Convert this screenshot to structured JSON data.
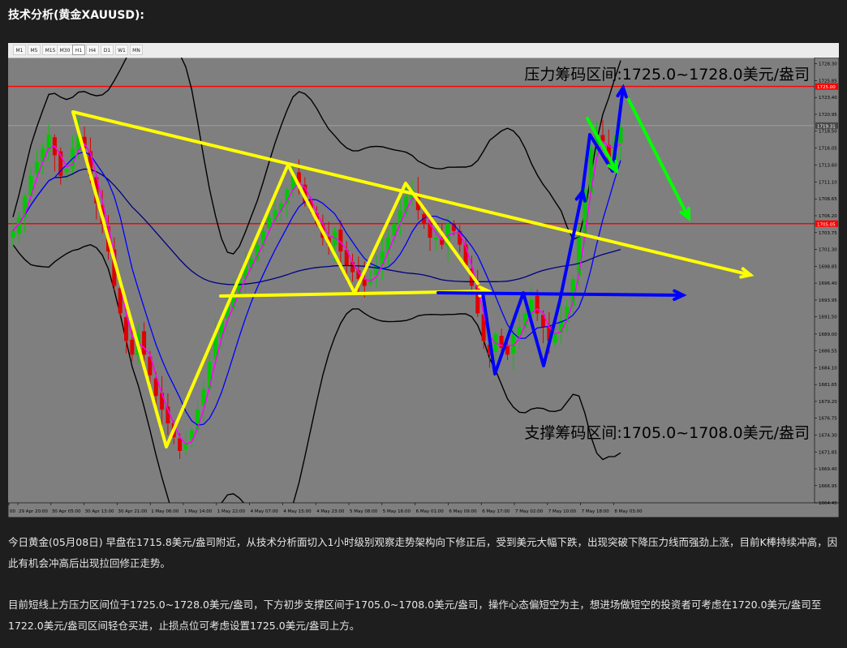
{
  "heading": "技术分析(黄金XAUUSD):",
  "timeframes": [
    "M1",
    "M5",
    "M15",
    "M30",
    "H1",
    "H4",
    "D1",
    "W1",
    "MN"
  ],
  "active_timeframe": "H1",
  "colors": {
    "background": "#7f7f7f",
    "bull_candle": "#00c800",
    "bear_candle": "#e00000",
    "trend_lines": "#ffff00",
    "resistance_line": "#ff0000",
    "arrow_up": "#0000ff",
    "arrow_down": "#00ff00",
    "bollinger": "#000000",
    "ma": "#0000ff",
    "ma_fast": "#ff00ff",
    "ma_slow": "#000080"
  },
  "chart_data": {
    "type": "candlestick",
    "ylim": [
      1664.45,
      1729.2
    ],
    "y_ticks": [
      "1728.30",
      "1725.85",
      "1723.40",
      "1720.95",
      "1718.50",
      "1716.05",
      "1713.60",
      "1711.10",
      "1708.65",
      "1706.20",
      "1703.75",
      "1701.30",
      "1698.85",
      "1696.40",
      "1693.95",
      "1691.50",
      "1689.00",
      "1686.55",
      "1684.10",
      "1681.65",
      "1679.20",
      "1676.75",
      "1674.30",
      "1671.85",
      "1669.40",
      "1666.95",
      "1664.45"
    ],
    "price_boxes": [
      "1725.00",
      "1719.31",
      "1705.05"
    ],
    "x_ticks": [
      "00",
      "29 Apr 20:00",
      "30 Apr 05:00",
      "30 Apr 13:00",
      "30 Apr 21:00",
      "1 May 06:00",
      "1 May 14:00",
      "1 May 22:00",
      "4 May 07:00",
      "4 May 15:00",
      "4 May 23:00",
      "5 May 08:00",
      "5 May 16:00",
      "6 May 01:00",
      "6 May 09:00",
      "6 May 17:00",
      "7 May 02:00",
      "7 May 10:00",
      "7 May 18:00",
      "8 May 03:00"
    ],
    "horizontal_levels": [
      1725.0,
      1705.05
    ],
    "resistance_label": "压力筹码区间:1725.0~1728.0美元/盎司",
    "support_label": "支撑筹码区间:1705.0~1708.0美元/盎司",
    "closes": [
      1704,
      1706,
      1709,
      1712,
      1714,
      1716,
      1718,
      1715,
      1712,
      1713,
      1716,
      1718,
      1716,
      1712,
      1708,
      1705,
      1701,
      1696,
      1692,
      1688,
      1686,
      1689,
      1686,
      1683,
      1680,
      1678,
      1676,
      1674,
      1672,
      1673,
      1675,
      1678,
      1681,
      1685,
      1689,
      1691,
      1693,
      1695,
      1697,
      1699,
      1700,
      1702,
      1704,
      1706,
      1707,
      1708,
      1710,
      1712,
      1711,
      1708,
      1707,
      1705,
      1703,
      1702,
      1704,
      1701,
      1699,
      1698,
      1697,
      1696,
      1697,
      1699,
      1701,
      1703,
      1705,
      1707,
      1709,
      1710,
      1707,
      1705,
      1703,
      1703,
      1702,
      1705,
      1704,
      1702,
      1699,
      1696,
      1692,
      1688,
      1686,
      1689,
      1687,
      1686,
      1689,
      1690,
      1692,
      1694,
      1692,
      1690,
      1688,
      1689,
      1691,
      1693,
      1697,
      1703,
      1710,
      1716,
      1718,
      1717,
      1714,
      1717,
      1719
    ]
  },
  "paragraphs": [
    "今日黄金(05月08日) 早盘在1715.8美元/盎司附近，从技术分析面切入1小时级别观察走势架构向下修正后，受到美元大幅下跌，出现突破下降压力线而强劲上涨，目前K棒持续冲高，因此有机会冲高后出现拉回修正走势。",
    "目前短线上方压力区间位于1725.0~1728.0美元/盎司，下方初步支撑区间于1705.0~1708.0美元/盎司，操作心态偏短空为主，想进场做短空的投资者可考虑在1720.0美元/盎司至1722.0美元/盎司区间轻仓买进，止损点位可考虑设置1725.0美元/盎司上方。"
  ]
}
